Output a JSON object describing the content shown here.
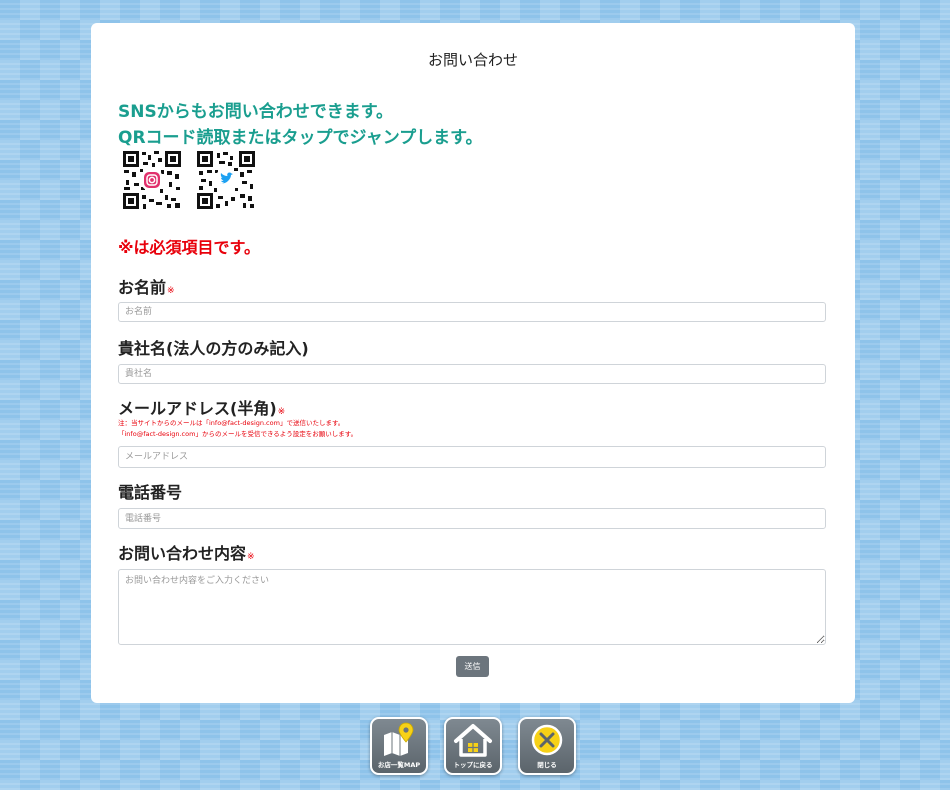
{
  "page": {
    "title": "お問い合わせ"
  },
  "sns": {
    "line1": "SNSからもお問い合わせできます。",
    "line2": "QRコード読取またはタップでジャンプします。",
    "qr_codes": [
      {
        "icon": "instagram-icon",
        "accent": "#e1306c"
      },
      {
        "icon": "twitter-icon",
        "accent": "#1da1f2"
      }
    ]
  },
  "required_note": "※は必須項目です。",
  "required_mark": "※",
  "form": {
    "name": {
      "label": "お名前",
      "placeholder": "お名前"
    },
    "company": {
      "label": "貴社名(法人の方のみ記入)",
      "placeholder": "貴社名"
    },
    "email": {
      "label": "メールアドレス(半角)",
      "note1": "注：当サイトからのメールは「info@fact-design.com」で送信いたします。",
      "note2": "「info@fact-design.com」からのメールを受信できるよう設定をお願いします。",
      "placeholder": "メールアドレス"
    },
    "phone": {
      "label": "電話番号",
      "placeholder": "電話番号"
    },
    "message": {
      "label": "お問い合わせ内容",
      "placeholder": "お問い合わせ内容をご入力ください"
    },
    "submit_label": "送信"
  },
  "nav": [
    {
      "label": "お店一覧MAP",
      "icon": "map-icon"
    },
    {
      "label": "トップに戻る",
      "icon": "home-icon"
    },
    {
      "label": "閉じる",
      "icon": "close-icon"
    }
  ],
  "colors": {
    "accent_teal": "#1a9e8f",
    "required_red": "#e8000b",
    "icon_yellow": "#f7d117",
    "background_blue": "#8ec3ea"
  }
}
